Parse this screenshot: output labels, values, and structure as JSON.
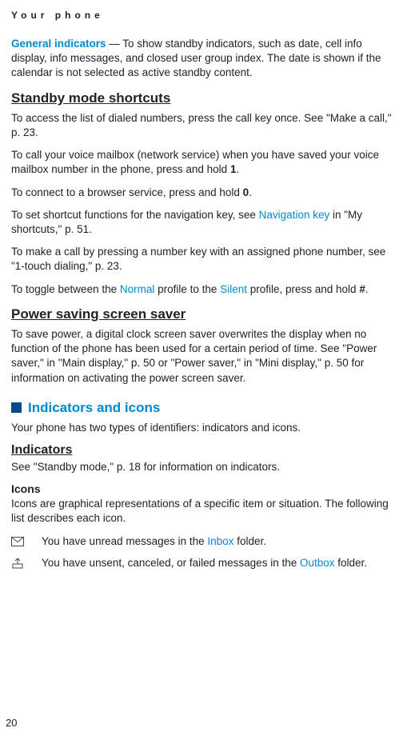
{
  "header": "Your phone",
  "page_number": "20",
  "general_indicators": {
    "label": "General indicators",
    "text": " — To show standby indicators, such as date, cell info display, info messages, and closed user group index. The date is shown if the calendar is not selected as active standby content."
  },
  "standby_shortcuts": {
    "heading": "Standby mode shortcuts",
    "p1": "To access the list of dialed numbers, press the call key once. See \"Make a call,\" p. 23.",
    "p2_pre": "To call your voice mailbox (network service) when you have saved your voice mailbox number in the phone, press and hold ",
    "p2_key": "1",
    "p2_post": ".",
    "p3_pre": "To connect to a browser service, press and hold ",
    "p3_key": "0",
    "p3_post": ".",
    "p4_pre": "To set shortcut functions for the navigation key, see ",
    "p4_link": "Navigation key",
    "p4_post": " in \"My shortcuts,\" p. 51.",
    "p5": "To make a call by pressing a number key with an assigned phone number, see \"1-touch dialing,\" p. 23.",
    "p6_pre": "To toggle between the ",
    "p6_normal": "Normal",
    "p6_mid": " profile to the ",
    "p6_silent": "Silent",
    "p6_post": " profile, press and hold ",
    "p6_key": "#",
    "p6_end": "."
  },
  "power_saver": {
    "heading": "Power saving screen saver",
    "text": "To save power, a digital clock screen saver overwrites the display when no function of the phone has been used for a certain period of time. See \"Power saver,\" in \"Main display,\" p. 50 or \"Power saver,\" in \"Mini display,\" p. 50 for information on activating the power screen saver."
  },
  "indicators_icons": {
    "heading": "Indicators and icons",
    "intro": "Your phone has two types of identifiers: indicators and icons.",
    "indicators_heading": "Indicators",
    "indicators_text": "See \"Standby mode,\" p. 18 for information on indicators.",
    "icons_heading": "Icons",
    "icons_text": "Icons are graphical representations of a specific item or situation. The following list describes each icon.",
    "row1_pre": "You have unread messages in the ",
    "row1_folder": "Inbox",
    "row1_post": " folder.",
    "row2_pre": "You have unsent, canceled, or failed messages in the ",
    "row2_folder": "Outbox",
    "row2_post": " folder."
  }
}
